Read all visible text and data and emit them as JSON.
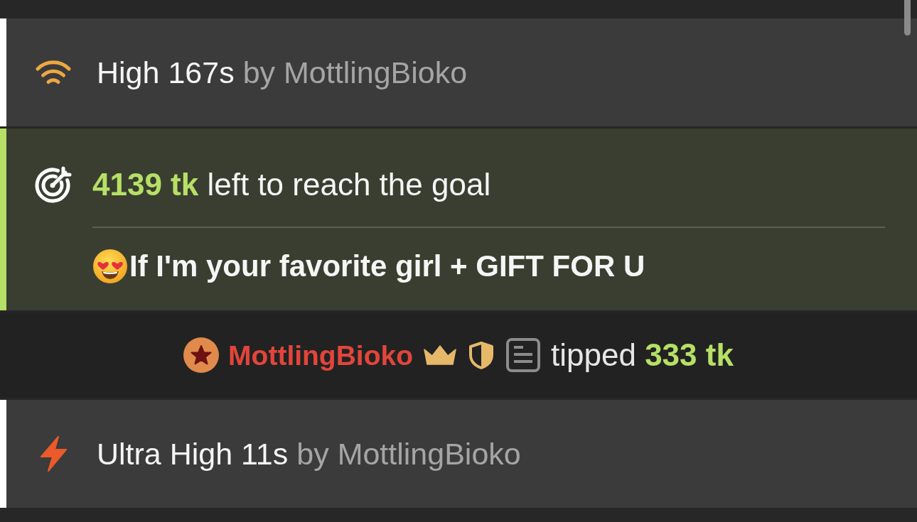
{
  "feed": [
    {
      "kind": "high",
      "title": "High 167s",
      "author": "by MottlingBioko"
    },
    {
      "kind": "goal",
      "remaining": "**4139 tk** left to reach the goal",
      "description": "If I'm your favorite girl + GIFT FOR U"
    },
    {
      "kind": "tip",
      "user": "MottlingBioko",
      "message": "tipped **333 tk**"
    },
    {
      "kind": "ultrahigh",
      "title": "Ultra High 11s",
      "author": "by MottlingBioko"
    }
  ]
}
